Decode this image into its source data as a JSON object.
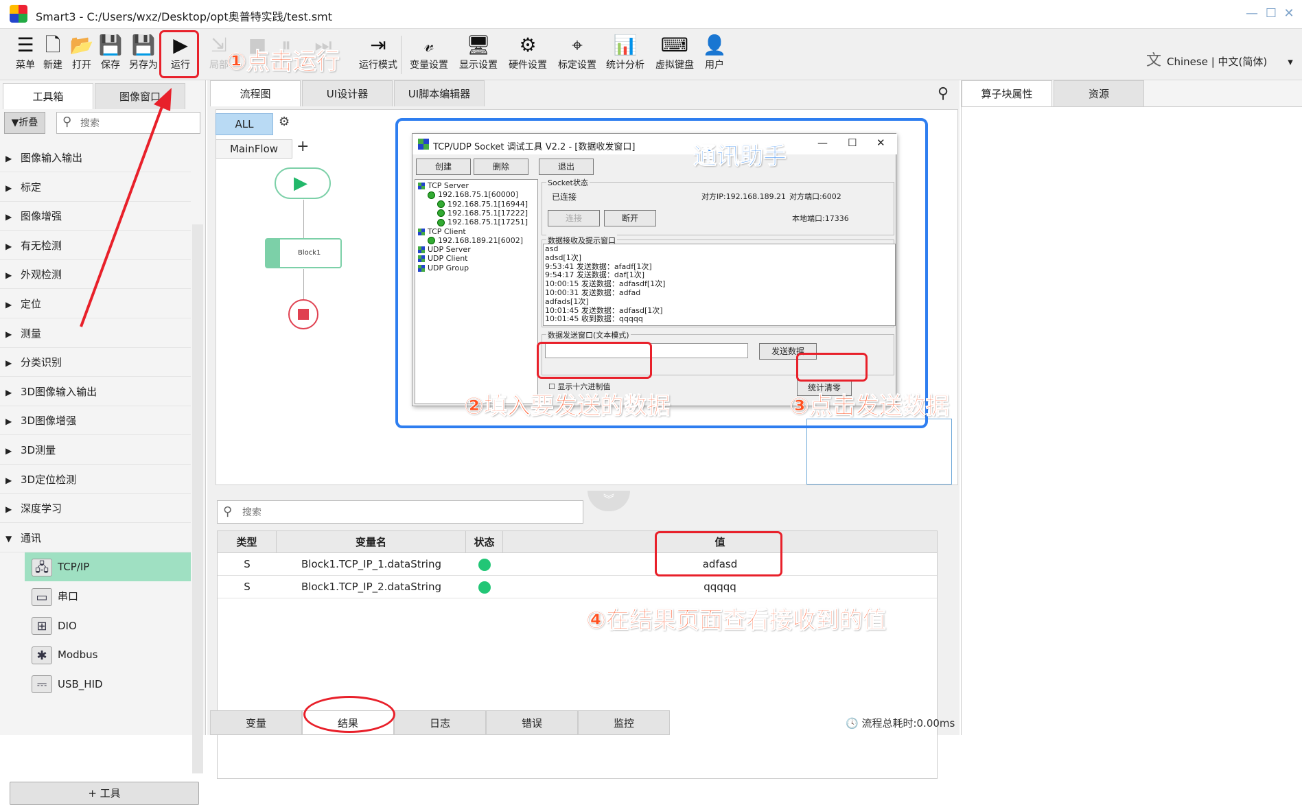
{
  "window": {
    "title": "Smart3 - C:/Users/wxz/Desktop/opt奥普特实践/test.smt",
    "controls": [
      "minimize",
      "maximize",
      "close"
    ]
  },
  "toolbar": {
    "buttons": [
      {
        "label": "菜单",
        "icon": "menu-icon",
        "enabled": true
      },
      {
        "label": "新建",
        "icon": "new-file-icon",
        "enabled": true
      },
      {
        "label": "打开",
        "icon": "folder-open-icon",
        "enabled": true
      },
      {
        "label": "保存",
        "icon": "save-icon",
        "enabled": true
      },
      {
        "label": "另存为",
        "icon": "save-as-icon",
        "enabled": true
      },
      {
        "label": "运行",
        "icon": "play-icon",
        "enabled": true
      },
      {
        "label": "局部",
        "icon": "step-icon",
        "enabled": false
      },
      {
        "label": "",
        "icon": "stop-icon",
        "enabled": false
      },
      {
        "label": "",
        "icon": "pause-icon",
        "enabled": false
      },
      {
        "label": "",
        "icon": "run-once-icon",
        "enabled": false
      },
      {
        "label": "运行模式",
        "icon": "run-mode-icon",
        "enabled": true
      },
      {
        "label": "变量设置",
        "icon": "variable-icon",
        "enabled": true
      },
      {
        "label": "显示设置",
        "icon": "display-icon",
        "enabled": true
      },
      {
        "label": "硬件设置",
        "icon": "hardware-icon",
        "enabled": true
      },
      {
        "label": "标定设置",
        "icon": "calibration-icon",
        "enabled": true
      },
      {
        "label": "统计分析",
        "icon": "statistics-icon",
        "enabled": true
      },
      {
        "label": "虚拟键盘",
        "icon": "keyboard-icon",
        "enabled": true
      },
      {
        "label": "用户",
        "icon": "user-icon",
        "enabled": true
      }
    ],
    "language": "Chinese | 中文(简体)"
  },
  "left_panel": {
    "tabs": [
      "工具箱",
      "图像窗口"
    ],
    "active_tab": 0,
    "fold_label": "▼折叠",
    "search_placeholder": "搜索",
    "categories": [
      "图像输入输出",
      "标定",
      "图像增强",
      "有无检测",
      "外观检测",
      "定位",
      "测量",
      "分类识别",
      "3D图像输入输出",
      "3D图像增强",
      "3D测量",
      "3D定位检测",
      "深度学习",
      "通讯"
    ],
    "comm_items": [
      {
        "label": "TCP/IP",
        "icon": "tcpip-icon",
        "selected": true
      },
      {
        "label": "串口",
        "icon": "serial-port-icon",
        "selected": false
      },
      {
        "label": "DIO",
        "icon": "dio-icon",
        "selected": false
      },
      {
        "label": "Modbus",
        "icon": "modbus-icon",
        "selected": false
      },
      {
        "label": "USB_HID",
        "icon": "usb-icon",
        "selected": false
      }
    ],
    "add_tool_label": "+ 工具"
  },
  "center": {
    "tabs": [
      "流程图",
      "UI设计器",
      "UI脚本编辑器"
    ],
    "active_tab": 0,
    "filter_label": "ALL",
    "flow_tab": "MainFlow",
    "block_label": "Block1"
  },
  "results": {
    "search_placeholder": "搜索",
    "columns": [
      "类型",
      "变量名",
      "状态",
      "值"
    ],
    "rows": [
      {
        "type": "S",
        "name": "Block1.TCP_IP_1.dataString",
        "status": "ok",
        "value": "adfasd"
      },
      {
        "type": "S",
        "name": "Block1.TCP_IP_2.dataString",
        "status": "ok",
        "value": "qqqqq"
      }
    ],
    "bottom_tabs": [
      "变量",
      "结果",
      "日志",
      "错误",
      "监控"
    ],
    "active_bottom_tab": 1,
    "runtime": "流程总耗时:0.00ms"
  },
  "right_panel": {
    "tabs": [
      "算子块属性",
      "资源"
    ],
    "active_tab": 0
  },
  "dialog": {
    "title": "TCP/UDP Socket 调试工具 V2.2 - [数据收发窗口]",
    "buttons": {
      "create": "创建",
      "delete": "删除",
      "exit": "退出",
      "connect": "连接",
      "disconnect": "断开",
      "send": "发送数据",
      "stats": "统计清零"
    },
    "tree": [
      {
        "label": "TCP Server",
        "level": 0,
        "kind": "root"
      },
      {
        "label": "192.168.75.1[60000]",
        "level": 1,
        "kind": "node"
      },
      {
        "label": "192.168.75.1[16944]",
        "level": 2,
        "kind": "leaf"
      },
      {
        "label": "192.168.75.1[17222]",
        "level": 2,
        "kind": "leaf"
      },
      {
        "label": "192.168.75.1[17251]",
        "level": 2,
        "kind": "leaf"
      },
      {
        "label": "TCP Client",
        "level": 0,
        "kind": "root"
      },
      {
        "label": "192.168.189.21[6002]",
        "level": 1,
        "kind": "leaf"
      },
      {
        "label": "UDP Server",
        "level": 0,
        "kind": "root"
      },
      {
        "label": "UDP Client",
        "level": 0,
        "kind": "root"
      },
      {
        "label": "UDP Group",
        "level": 0,
        "kind": "root"
      }
    ],
    "socket_group": "Socket状态",
    "status": "已连接",
    "peer_ip": "对方IP:192.168.189.21",
    "peer_port": "对方端口:6002",
    "local_port": "本地端口:17336",
    "recv_group": "数据接收及提示窗口",
    "recv_lines": [
      "asd",
      "adsd[1次]",
      "9:53:41 发送数据：afadf[1次]",
      "9:54:17 发送数据：daf[1次]",
      "10:00:15 发送数据：adfasdf[1次]",
      "10:00:31 发送数据：adfad",
      "adfads[1次]",
      "10:01:45 发送数据：adfasd[1次]",
      "10:01:45 收到数据：qqqqq"
    ],
    "send_group": "数据发送窗口(文本模式)",
    "hex_label": "显示十六进制值",
    "send_value": ""
  },
  "annotations": {
    "step1": "①点击运行",
    "helper": "通讯助手",
    "step2": "②填入要发送的数据",
    "step3": "③点击发送数据",
    "step4": "④在结果页面查看接收到的值"
  }
}
